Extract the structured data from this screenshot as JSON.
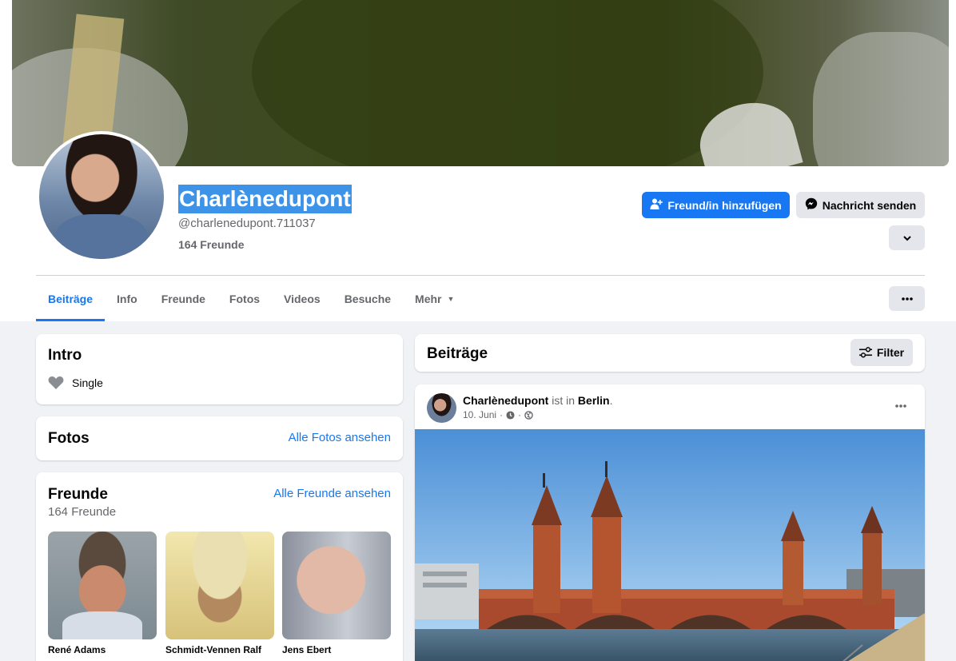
{
  "cover": {
    "icon": "cover-photo"
  },
  "profile": {
    "name": "Charlènedupont",
    "handle": "@charlenedupont.711037",
    "friends_count": "164 Freunde"
  },
  "actions": {
    "add_friend": "Freund/in hinzufügen",
    "message": "Nachricht senden"
  },
  "tabs": [
    {
      "label": "Beiträge",
      "active": true
    },
    {
      "label": "Info"
    },
    {
      "label": "Freunde"
    },
    {
      "label": "Fotos"
    },
    {
      "label": "Videos"
    },
    {
      "label": "Besuche"
    },
    {
      "label": "Mehr"
    }
  ],
  "intro": {
    "title": "Intro",
    "relationship": "Single"
  },
  "fotos": {
    "title": "Fotos",
    "link": "Alle Fotos ansehen"
  },
  "freunde": {
    "title": "Freunde",
    "link": "Alle Freunde ansehen",
    "count": "164 Freunde",
    "list": [
      {
        "name": "René Adams"
      },
      {
        "name": "Schmidt-Vennen Ralf"
      },
      {
        "name": "Jens Ebert"
      }
    ]
  },
  "beitraege": {
    "title": "Beiträge",
    "filter": "Filter"
  },
  "post": {
    "author": "Charlènedupont",
    "is_in": "ist in",
    "place": "Berlin",
    "period": ".",
    "date": "10. Juni",
    "sep": "·"
  },
  "colors": {
    "accent": "#1877f2",
    "selection": "#3d93e8",
    "secondary_text": "#65676b"
  }
}
